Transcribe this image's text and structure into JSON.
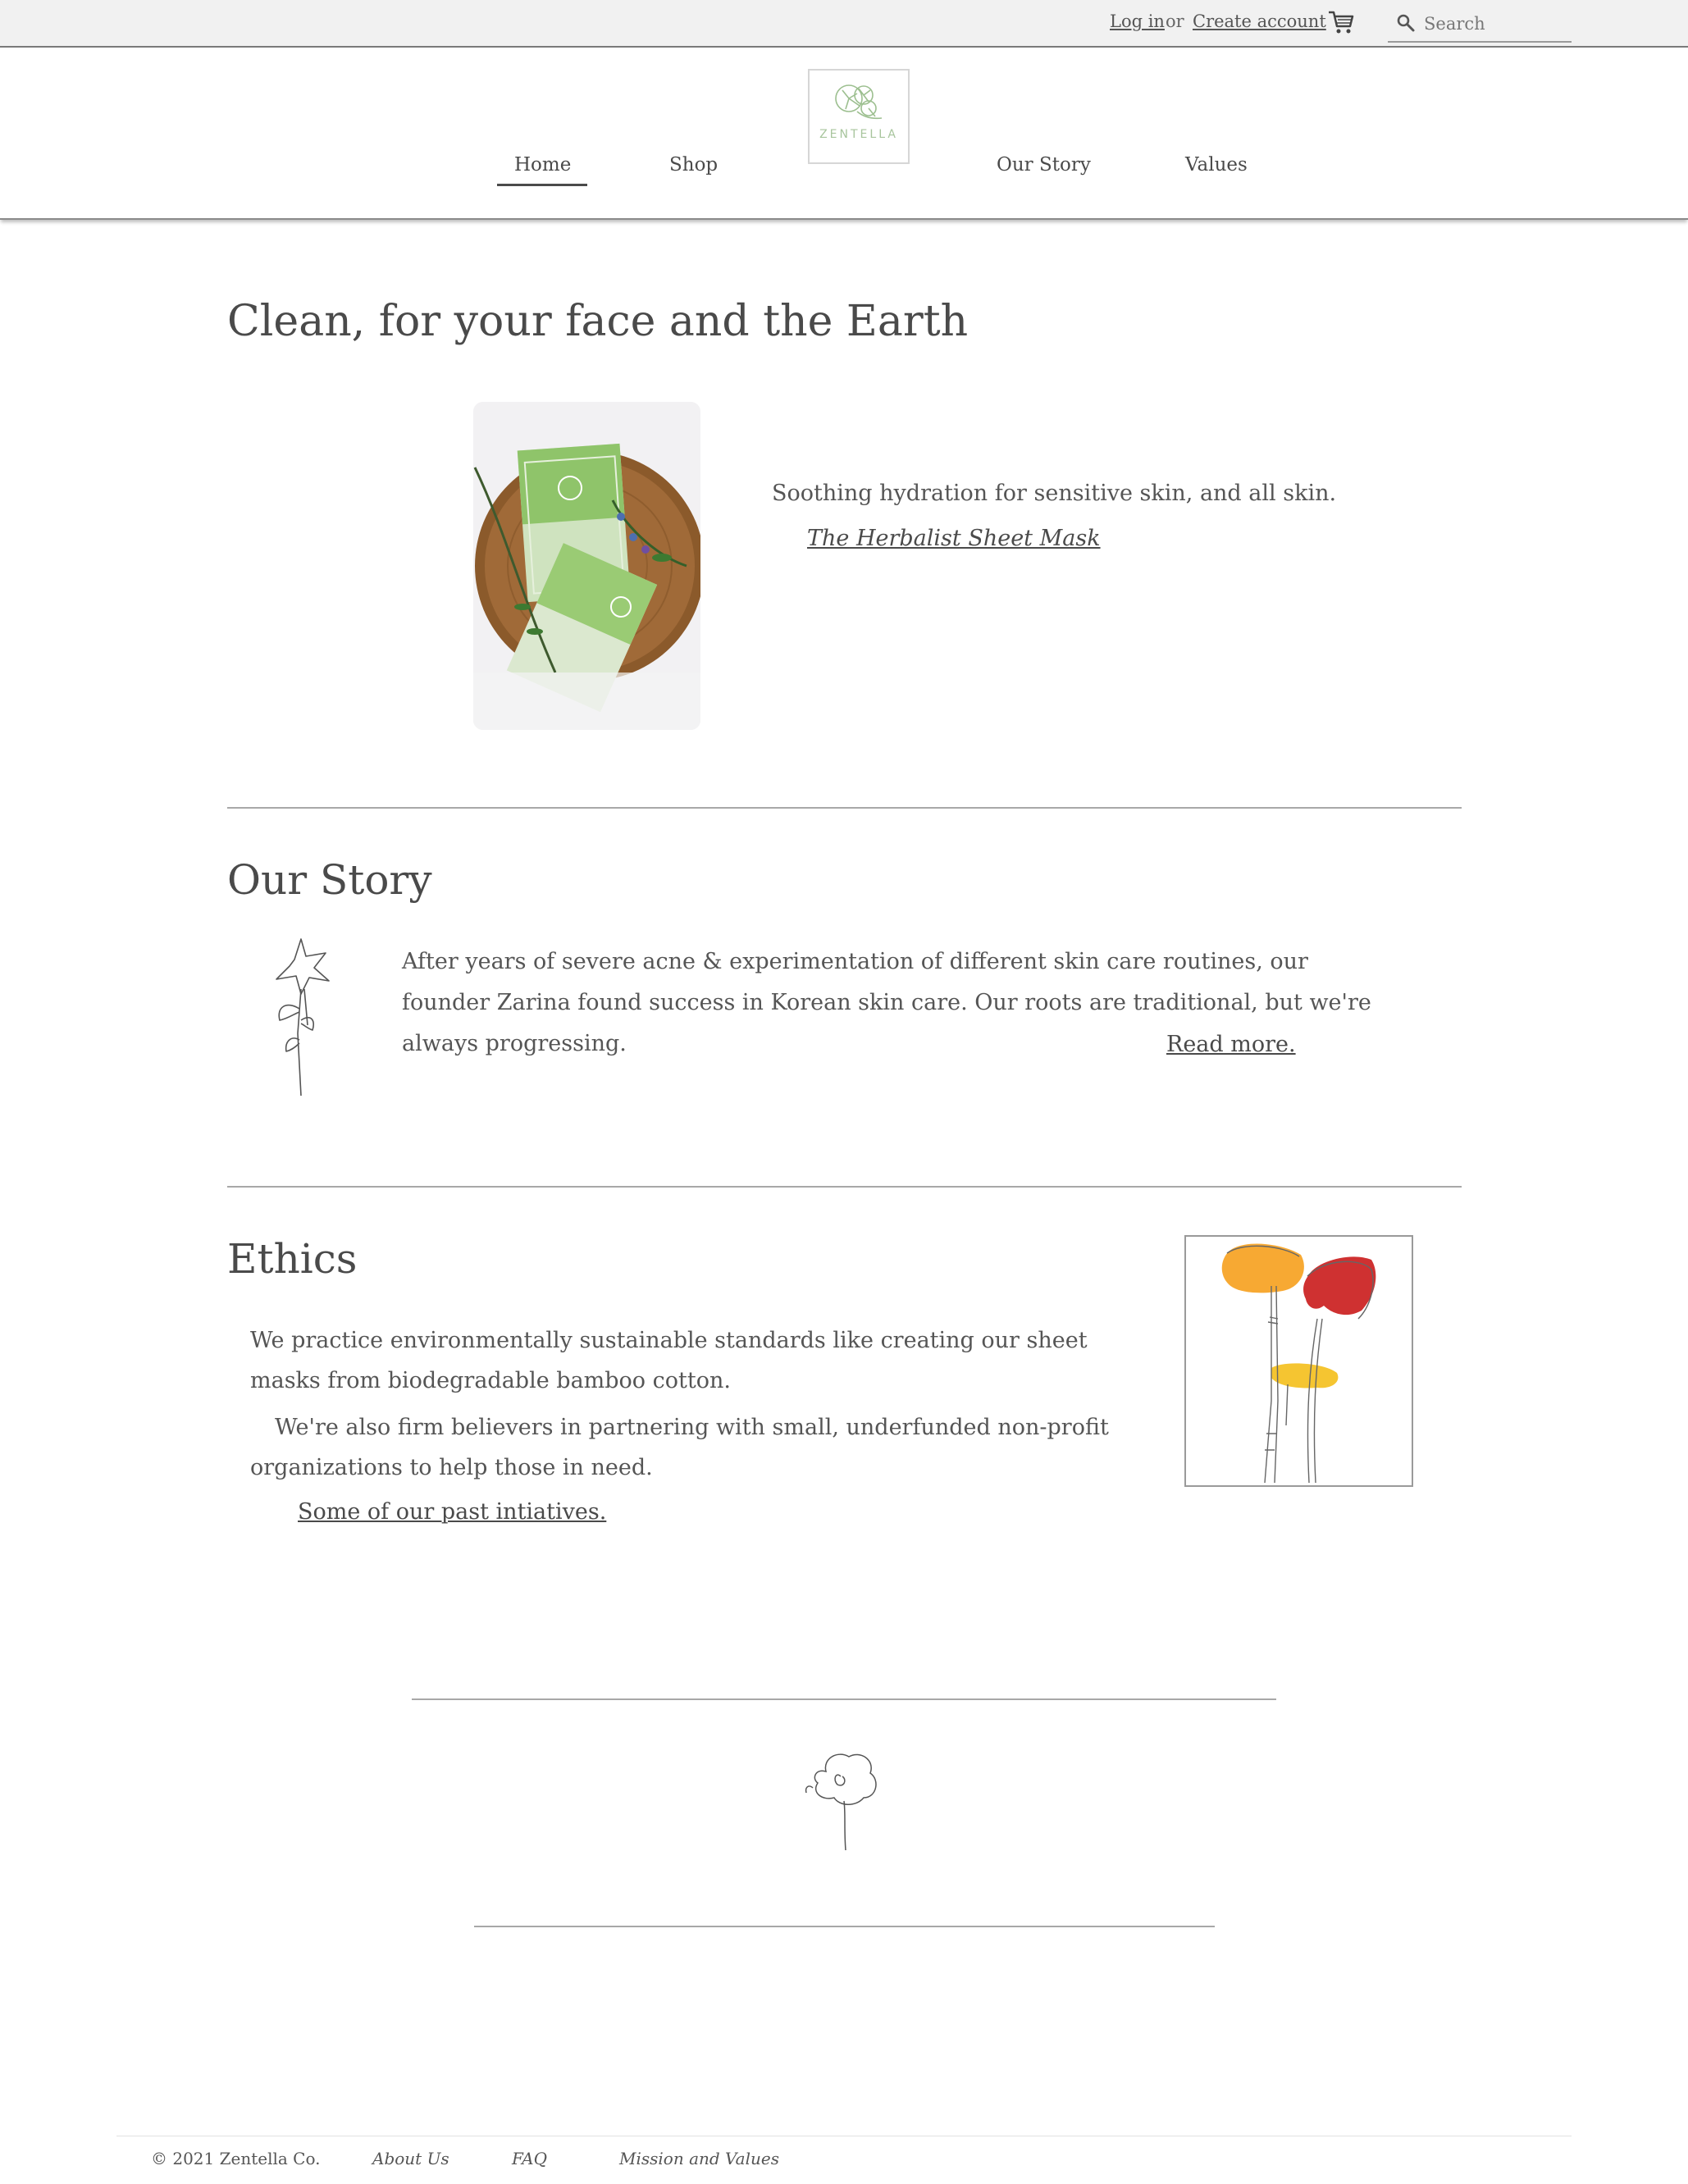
{
  "topbar": {
    "login": "Log in",
    "or": "or",
    "create_account": "Create account",
    "search_placeholder": "Search"
  },
  "brand": {
    "name": "ZENTELLA"
  },
  "nav": {
    "items": [
      {
        "label": "Home",
        "active": true
      },
      {
        "label": "Shop"
      },
      {
        "label": "Our Story"
      },
      {
        "label": "Values"
      }
    ]
  },
  "hero": {
    "title": "Clean, for your face and the Earth",
    "tagline": "Soothing hydration for sensitive skin, and all skin.",
    "product_link": "The Herbalist Sheet Mask"
  },
  "story": {
    "title": "Our Story",
    "text": "After years of severe acne & experimentation of different skin care routines, our founder Zarina found success in Korean skin care. Our roots are traditional, but we're always progressing.",
    "read_more": "Read more."
  },
  "ethics": {
    "title": "Ethics",
    "p1": "We practice environmentally sustainable standards like creating our sheet masks from biodegradable bamboo cotton.",
    "p2": "We're also firm believers in partnering with small, underfunded non-profit organizations to help those in need.",
    "link": "Some of our past intiatives."
  },
  "footer": {
    "copyright": "© 2021 Zentella Co.",
    "links": [
      "About Us",
      "FAQ",
      "Mission and Values"
    ]
  },
  "colors": {
    "text": "#4a4a4a",
    "topbar_bg": "#f1f1f1",
    "logo_green": "#a8c59d",
    "flower_orange": "#f7a933",
    "flower_red": "#cf3131",
    "flower_yellow": "#f5c531"
  }
}
